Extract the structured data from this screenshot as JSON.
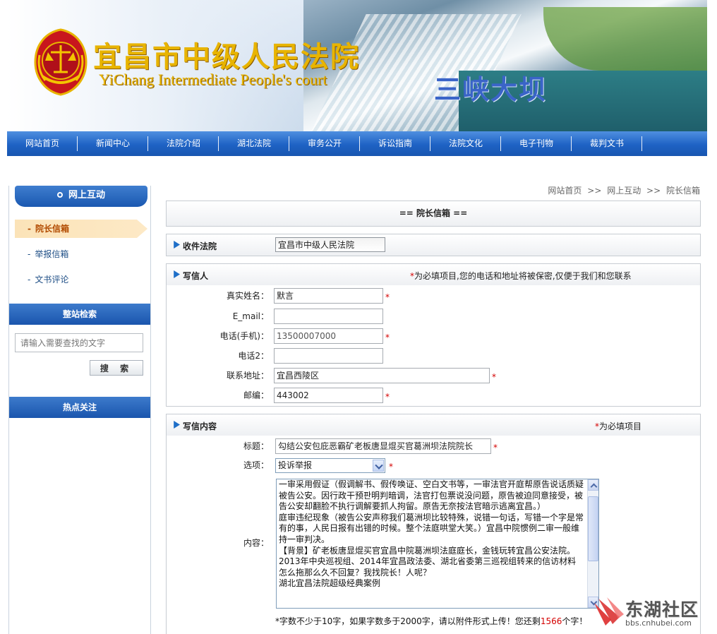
{
  "header": {
    "title_cn": "宜昌市中级人民法院",
    "title_en": "YiChang Intermediate People's court",
    "slogan": "三峡大坝",
    "emblem_icon": "court-emblem-icon"
  },
  "nav": {
    "items": [
      "网站首页",
      "新闻中心",
      "法院介绍",
      "湖北法院",
      "审务公开",
      "诉讼指南",
      "法院文化",
      "电子刊物",
      "裁判文书"
    ]
  },
  "sidebar": {
    "section_title": "网上互动",
    "links": [
      {
        "label": "院长信箱",
        "active": true
      },
      {
        "label": "举报信箱",
        "active": false
      },
      {
        "label": "文书评论",
        "active": false
      }
    ],
    "search_title": "整站检索",
    "search_placeholder": "请输入需要查找的文字",
    "search_button": "搜 索",
    "hot_title": "热点关注"
  },
  "breadcrumb": {
    "home": "网站首页",
    "sep1": ">>",
    "level1": "网上互动",
    "sep2": ">>",
    "current": "院长信箱"
  },
  "page_title": "== 院长信箱 ==",
  "recipient": {
    "label": "收件法院",
    "value": "宜昌市中级人民法院"
  },
  "writer": {
    "section_label": "写信人",
    "required_star": "*",
    "required_note": "为必填项目,您的电话和地址将被保密,仅便于我们和您联系",
    "fields": {
      "name": {
        "label": "真实姓名：",
        "value": "默言"
      },
      "email": {
        "label": "E_mail：",
        "value": ""
      },
      "phone": {
        "label": "电话(手机)：",
        "value": "13500007000"
      },
      "phone2": {
        "label": "电话2：",
        "value": ""
      },
      "address": {
        "label": "联系地址：",
        "value": "宜昌西陵区"
      },
      "zip": {
        "label": "邮编：",
        "value": "443002"
      }
    },
    "star": "*"
  },
  "content": {
    "section_label": "写信内容",
    "required_star": "*",
    "required_note": "为必填项目",
    "subject_label": "标题：",
    "subject_value": "勾结公安包庇恶霸矿老板唐显焜买官葛洲坝法院院长",
    "option_label": "选项：",
    "option_value": "投诉举报",
    "body_label": "内容：",
    "body_text": "一审采用假证（假调解书、假传唤证、空白文书等，一审法官开庭帮原告说话质疑被告公安。因行政干预판明判暗调，法官打包票说没问题，原告被迫同意接受，被告公安却翻脸不执行调解要抓人拘留。原告无奈按法官暗示逃离宜昌。）\n庭审违纪现象（被告公安声称我们葛洲坝比较特殊，说错一句话，写错一个字是常有的事，人民日报有出错的时候。整个法庭哄堂大笑。）宜昌中院惯例二审一般维持一审判决。\n【背景】矿老板唐显焜买官宜昌中院葛洲坝法庭庭长，金钱玩转宜昌公安法院。\n2013年中央巡视组、2014年宜昌政法委、湖北省委第三巡视组转来的信访材料怎么拖那么久不回复？我找院长！人呢？\n湖北宜昌法院超级经典案例",
    "hint_prefix": "*字数不少于10字，如果字数多于2000字，请以附件形式上传！您还剩",
    "remaining": "1566",
    "hint_suffix": "个字！"
  },
  "watermark": {
    "name": "东湖社区",
    "url": "bbs.cnhubei.com"
  },
  "colors": {
    "nav_blue": "#1e62c4",
    "required_red": "#d40000",
    "title_gold": "#e8b400",
    "slogan_blue": "#3a64c8"
  }
}
